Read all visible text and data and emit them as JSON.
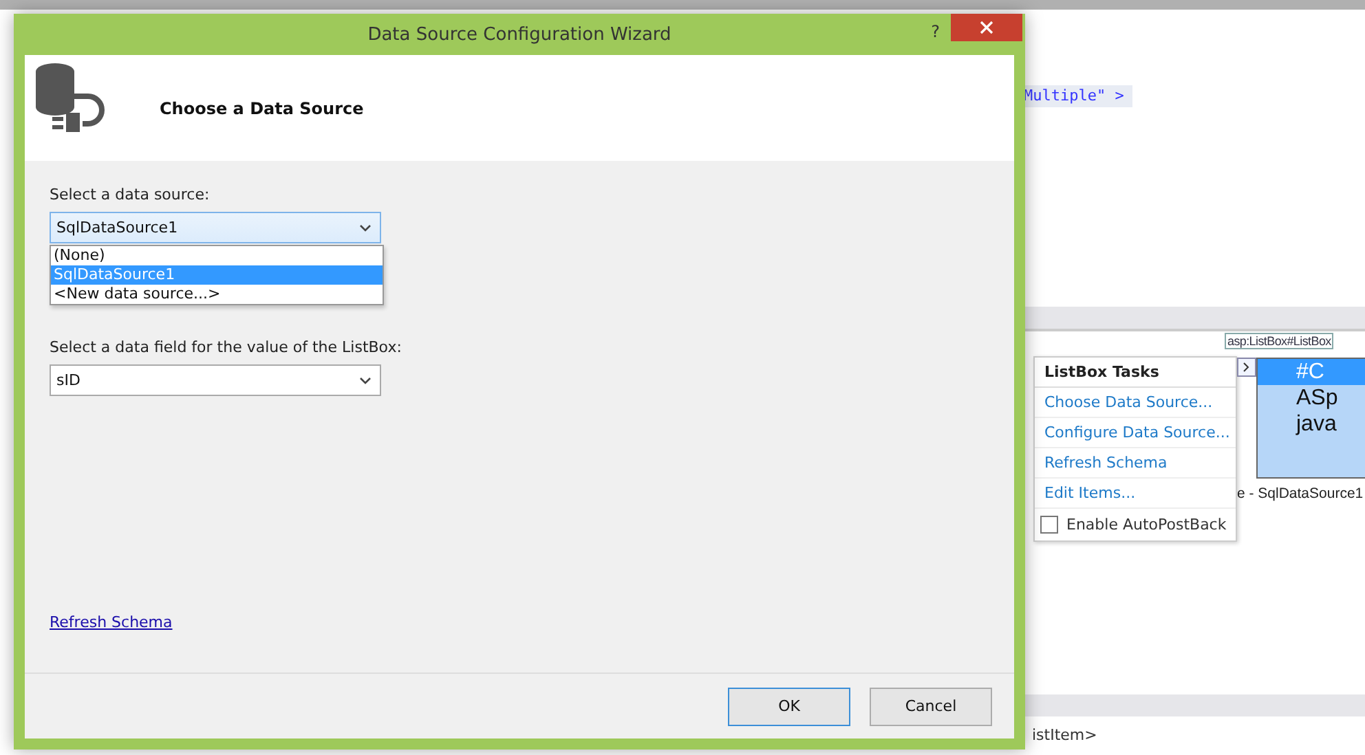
{
  "window": {
    "title": "Data Source Configuration Wizard",
    "help": "?"
  },
  "header": {
    "title": "Choose a Data Source"
  },
  "data_source": {
    "label": "Select a data source:",
    "value": "SqlDataSource1",
    "expanded": true,
    "options": [
      {
        "label": "(None)",
        "selected": false
      },
      {
        "label": "SqlDataSource1",
        "selected": true
      },
      {
        "label": "<New data source...>",
        "selected": false
      }
    ]
  },
  "value_field": {
    "label": "Select a data field for the value of the ListBox:",
    "value": "sID"
  },
  "refresh_link": "Refresh Schema",
  "buttons": [
    {
      "label": "OK",
      "default": true
    },
    {
      "label": "Cancel",
      "default": false
    }
  ],
  "editor": {
    "code_fragment": "Multiple\" >",
    "element_tag": "asp:ListBox#ListBox",
    "tasks": {
      "title": "ListBox Tasks",
      "items": [
        "Choose Data Source...",
        "Configure Data Source...",
        "Refresh Schema",
        "Edit Items..."
      ],
      "autopostback": {
        "label": "Enable AutoPostBack",
        "checked": false
      }
    },
    "listbox_items": [
      {
        "label": "#C",
        "selected": true
      },
      {
        "label": "ASp",
        "selected": false
      },
      {
        "label": "java",
        "selected": false
      }
    ],
    "caption": "e - SqlDataSource1",
    "bottom_tag": "istItem>"
  }
}
